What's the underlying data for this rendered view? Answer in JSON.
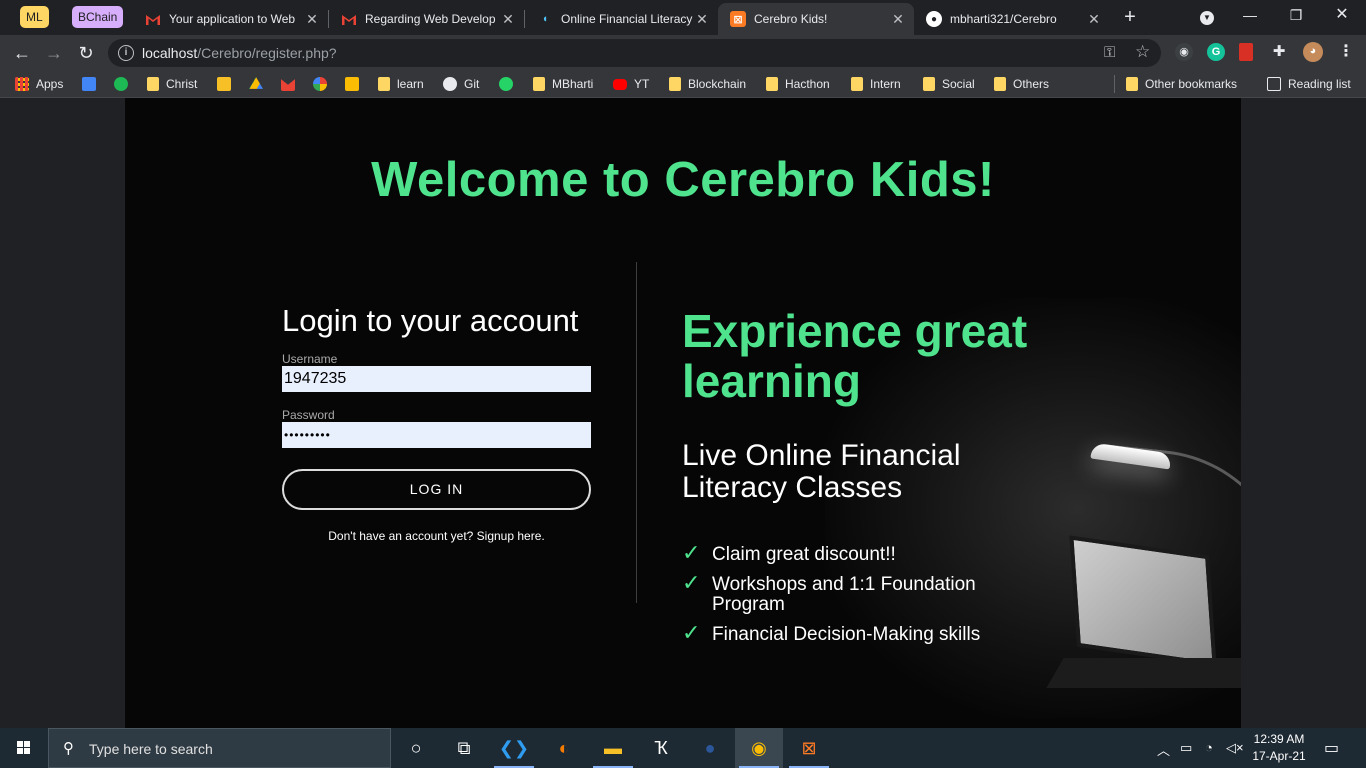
{
  "browser": {
    "tab_groups": [
      {
        "label": "ML",
        "color": "#fdd663"
      },
      {
        "label": "BChain",
        "color": "#d7aefb"
      }
    ],
    "tabs": [
      {
        "title": "Your application to Web",
        "icon": "gmail-icon"
      },
      {
        "title": "Regarding Web Develop",
        "icon": "gmail-icon"
      },
      {
        "title": "Online Financial Literacy",
        "icon": "site-icon"
      },
      {
        "title": "Cerebro Kids!",
        "icon": "xampp-icon",
        "active": true
      },
      {
        "title": "mbharti321/Cerebro",
        "icon": "github-icon"
      }
    ],
    "address": {
      "host": "localhost",
      "path": "/Cerebro/register.php?"
    },
    "bookmarks": [
      {
        "label": "Apps",
        "icon": "apps-grid-icon"
      },
      {
        "label": "",
        "icon": "google-sheets-icon"
      },
      {
        "label": "",
        "icon": "spotify-icon"
      },
      {
        "label": "Christ",
        "icon": "folder-icon"
      },
      {
        "label": "",
        "icon": "google-classroom-icon"
      },
      {
        "label": "",
        "icon": "google-drive-icon"
      },
      {
        "label": "",
        "icon": "gmail-icon"
      },
      {
        "label": "",
        "icon": "google-photos-icon"
      },
      {
        "label": "",
        "icon": "google-keep-icon"
      },
      {
        "label": "learn",
        "icon": "folder-icon"
      },
      {
        "label": "Git",
        "icon": "github-icon"
      },
      {
        "label": "",
        "icon": "whatsapp-icon"
      },
      {
        "label": "MBharti",
        "icon": "folder-icon"
      },
      {
        "label": "YT",
        "icon": "youtube-icon"
      },
      {
        "label": "Blockchain",
        "icon": "folder-icon"
      },
      {
        "label": "Hacthon",
        "icon": "folder-icon"
      },
      {
        "label": "Intern",
        "icon": "folder-icon"
      },
      {
        "label": "Social",
        "icon": "folder-icon"
      },
      {
        "label": "Others",
        "icon": "folder-icon"
      }
    ],
    "other_bookmarks": "Other bookmarks",
    "reading_list": "Reading list"
  },
  "page": {
    "welcome": "Welcome to Cerebro Kids!",
    "login": {
      "title": "Login to your account",
      "username_label": "Username",
      "username_value": "1947235",
      "password_label": "Password",
      "password_value": "•••••••••",
      "button": "LOG IN",
      "signup_text": "Don't have an account yet? Signup here."
    },
    "promo": {
      "title": "Exprience great learning",
      "subtitle": "Live Online Financial Literacy Classes",
      "features": [
        "Claim great discount!!",
        "Workshops and 1:1 Foundation Program",
        "Financial Decision-Making skills"
      ],
      "check_glyph": "✓",
      "accent_color": "#4fe38e"
    }
  },
  "taskbar": {
    "search_placeholder": "Type here to search",
    "apps": [
      "cortana-icon",
      "task-view-icon",
      "vscode-icon",
      "eclipse-icon",
      "file-explorer-icon",
      "app-icon",
      "word-icon",
      "chrome-icon",
      "xampp-icon"
    ],
    "time": "12:39 AM",
    "date": "17-Apr-21"
  }
}
